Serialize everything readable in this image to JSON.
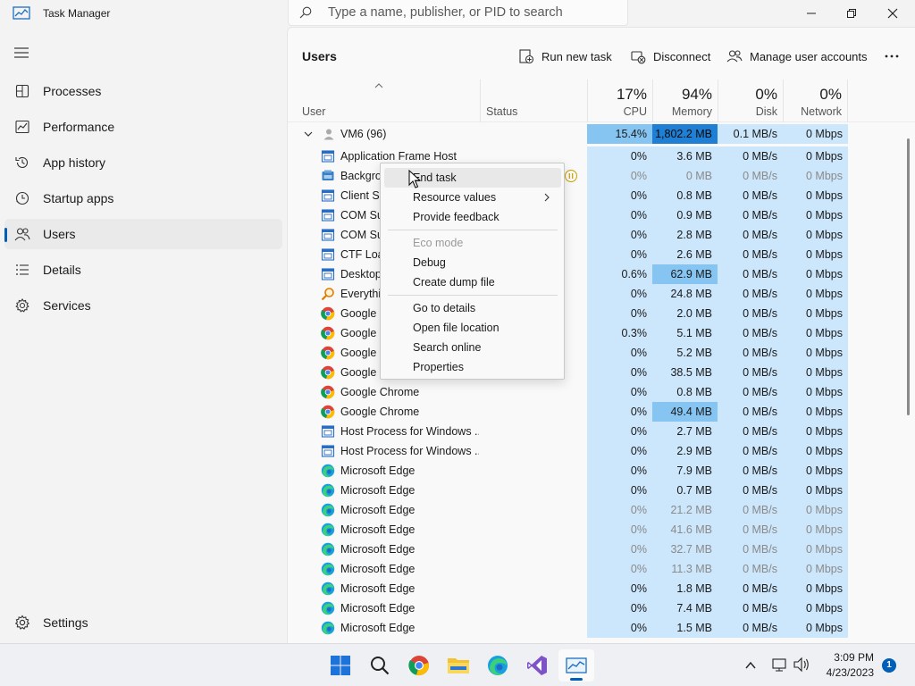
{
  "window": {
    "title": "Task Manager"
  },
  "search": {
    "placeholder": "Type a name, publisher, or PID to search"
  },
  "sidebar": {
    "items": [
      {
        "label": "Processes",
        "icon": "processes-icon"
      },
      {
        "label": "Performance",
        "icon": "performance-icon"
      },
      {
        "label": "App history",
        "icon": "app-history-icon"
      },
      {
        "label": "Startup apps",
        "icon": "startup-apps-icon"
      },
      {
        "label": "Users",
        "icon": "users-icon",
        "active": true
      },
      {
        "label": "Details",
        "icon": "details-icon"
      },
      {
        "label": "Services",
        "icon": "services-icon"
      }
    ],
    "settings_label": "Settings"
  },
  "toolbar": {
    "page_title": "Users",
    "run_new_task": "Run new task",
    "disconnect": "Disconnect",
    "manage_user_accounts": "Manage user accounts"
  },
  "columns": {
    "user": "User",
    "status": "Status",
    "cpu": {
      "label": "CPU",
      "pct": "17%"
    },
    "memory": {
      "label": "Memory",
      "pct": "94%"
    },
    "disk": {
      "label": "Disk",
      "pct": "0%"
    },
    "network": {
      "label": "Network",
      "pct": "0%"
    }
  },
  "group": {
    "name": "VM6 (96)",
    "cpu": "15.4%",
    "memory": "1,802.2 MB",
    "disk": "0.1 MB/s",
    "network": "0 Mbps"
  },
  "rows": [
    {
      "name": "Application Frame Host",
      "icon": "app-window-icon",
      "cpu": "0%",
      "memory": "3.6 MB",
      "disk": "0 MB/s",
      "network": "0 Mbps"
    },
    {
      "name": "Backgro",
      "icon": "background-task-icon",
      "cpu": "0%",
      "memory": "0 MB",
      "disk": "0 MB/s",
      "network": "0 Mbps",
      "dim": true,
      "paused": true
    },
    {
      "name": "Client Se",
      "icon": "app-window-icon",
      "cpu": "0%",
      "memory": "0.8 MB",
      "disk": "0 MB/s",
      "network": "0 Mbps"
    },
    {
      "name": "COM Su",
      "icon": "app-window-icon",
      "cpu": "0%",
      "memory": "0.9 MB",
      "disk": "0 MB/s",
      "network": "0 Mbps"
    },
    {
      "name": "COM Su",
      "icon": "app-window-icon",
      "cpu": "0%",
      "memory": "2.8 MB",
      "disk": "0 MB/s",
      "network": "0 Mbps"
    },
    {
      "name": "CTF Load",
      "icon": "app-window-icon",
      "cpu": "0%",
      "memory": "2.6 MB",
      "disk": "0 MB/s",
      "network": "0 Mbps"
    },
    {
      "name": "Desktop",
      "icon": "app-window-icon",
      "cpu": "0.6%",
      "memory": "62.9 MB",
      "disk": "0 MB/s",
      "network": "0 Mbps",
      "mem_hl": true
    },
    {
      "name": "Everythin",
      "icon": "everything-search-icon",
      "cpu": "0%",
      "memory": "24.8 MB",
      "disk": "0 MB/s",
      "network": "0 Mbps"
    },
    {
      "name": "Google C",
      "icon": "chrome-icon",
      "cpu": "0%",
      "memory": "2.0 MB",
      "disk": "0 MB/s",
      "network": "0 Mbps"
    },
    {
      "name": "Google C",
      "icon": "chrome-icon",
      "cpu": "0.3%",
      "memory": "5.1 MB",
      "disk": "0 MB/s",
      "network": "0 Mbps"
    },
    {
      "name": "Google C",
      "icon": "chrome-icon",
      "cpu": "0%",
      "memory": "5.2 MB",
      "disk": "0 MB/s",
      "network": "0 Mbps"
    },
    {
      "name": "Google C",
      "icon": "chrome-icon",
      "cpu": "0%",
      "memory": "38.5 MB",
      "disk": "0 MB/s",
      "network": "0 Mbps"
    },
    {
      "name": "Google Chrome",
      "icon": "chrome-icon",
      "cpu": "0%",
      "memory": "0.8 MB",
      "disk": "0 MB/s",
      "network": "0 Mbps"
    },
    {
      "name": "Google Chrome",
      "icon": "chrome-icon",
      "cpu": "0%",
      "memory": "49.4 MB",
      "disk": "0 MB/s",
      "network": "0 Mbps",
      "mem_hl": true
    },
    {
      "name": "Host Process for Windows ...",
      "icon": "app-window-icon",
      "cpu": "0%",
      "memory": "2.7 MB",
      "disk": "0 MB/s",
      "network": "0 Mbps"
    },
    {
      "name": "Host Process for Windows ...",
      "icon": "app-window-icon",
      "cpu": "0%",
      "memory": "2.9 MB",
      "disk": "0 MB/s",
      "network": "0 Mbps"
    },
    {
      "name": "Microsoft Edge",
      "icon": "edge-icon",
      "cpu": "0%",
      "memory": "7.9 MB",
      "disk": "0 MB/s",
      "network": "0 Mbps"
    },
    {
      "name": "Microsoft Edge",
      "icon": "edge-icon",
      "cpu": "0%",
      "memory": "0.7 MB",
      "disk": "0 MB/s",
      "network": "0 Mbps"
    },
    {
      "name": "Microsoft Edge",
      "icon": "edge-icon",
      "cpu": "0%",
      "memory": "21.2 MB",
      "disk": "0 MB/s",
      "network": "0 Mbps",
      "dim": true
    },
    {
      "name": "Microsoft Edge",
      "icon": "edge-icon",
      "cpu": "0%",
      "memory": "41.6 MB",
      "disk": "0 MB/s",
      "network": "0 Mbps",
      "dim": true
    },
    {
      "name": "Microsoft Edge",
      "icon": "edge-icon",
      "cpu": "0%",
      "memory": "32.7 MB",
      "disk": "0 MB/s",
      "network": "0 Mbps",
      "dim": true
    },
    {
      "name": "Microsoft Edge",
      "icon": "edge-icon",
      "cpu": "0%",
      "memory": "11.3 MB",
      "disk": "0 MB/s",
      "network": "0 Mbps",
      "dim": true
    },
    {
      "name": "Microsoft Edge",
      "icon": "edge-icon",
      "cpu": "0%",
      "memory": "1.8 MB",
      "disk": "0 MB/s",
      "network": "0 Mbps"
    },
    {
      "name": "Microsoft Edge",
      "icon": "edge-icon",
      "cpu": "0%",
      "memory": "7.4 MB",
      "disk": "0 MB/s",
      "network": "0 Mbps"
    },
    {
      "name": "Microsoft Edge",
      "icon": "edge-icon",
      "cpu": "0%",
      "memory": "1.5 MB",
      "disk": "0 MB/s",
      "network": "0 Mbps"
    }
  ],
  "context_menu": {
    "items": [
      {
        "label": "End task",
        "hover": true
      },
      {
        "label": "Resource values",
        "submenu": true
      },
      {
        "label": "Provide feedback"
      },
      {
        "sep": true
      },
      {
        "label": "Eco mode",
        "disabled": true
      },
      {
        "label": "Debug"
      },
      {
        "label": "Create dump file"
      },
      {
        "sep": true
      },
      {
        "label": "Go to details"
      },
      {
        "label": "Open file location"
      },
      {
        "label": "Search online"
      },
      {
        "label": "Properties"
      }
    ]
  },
  "taskbar": {
    "apps": [
      "start-icon",
      "search-icon",
      "chrome-icon",
      "file-explorer-icon",
      "edge-icon",
      "visual-studio-icon",
      "task-manager-icon"
    ],
    "time": "3:09 PM",
    "date": "4/23/2023",
    "notification_count": "1"
  },
  "colors": {
    "accent": "#005fb8",
    "heat_low": "#cce6fb",
    "heat_mid": "#86c4f2",
    "heat_high": "#1f7fd4"
  }
}
